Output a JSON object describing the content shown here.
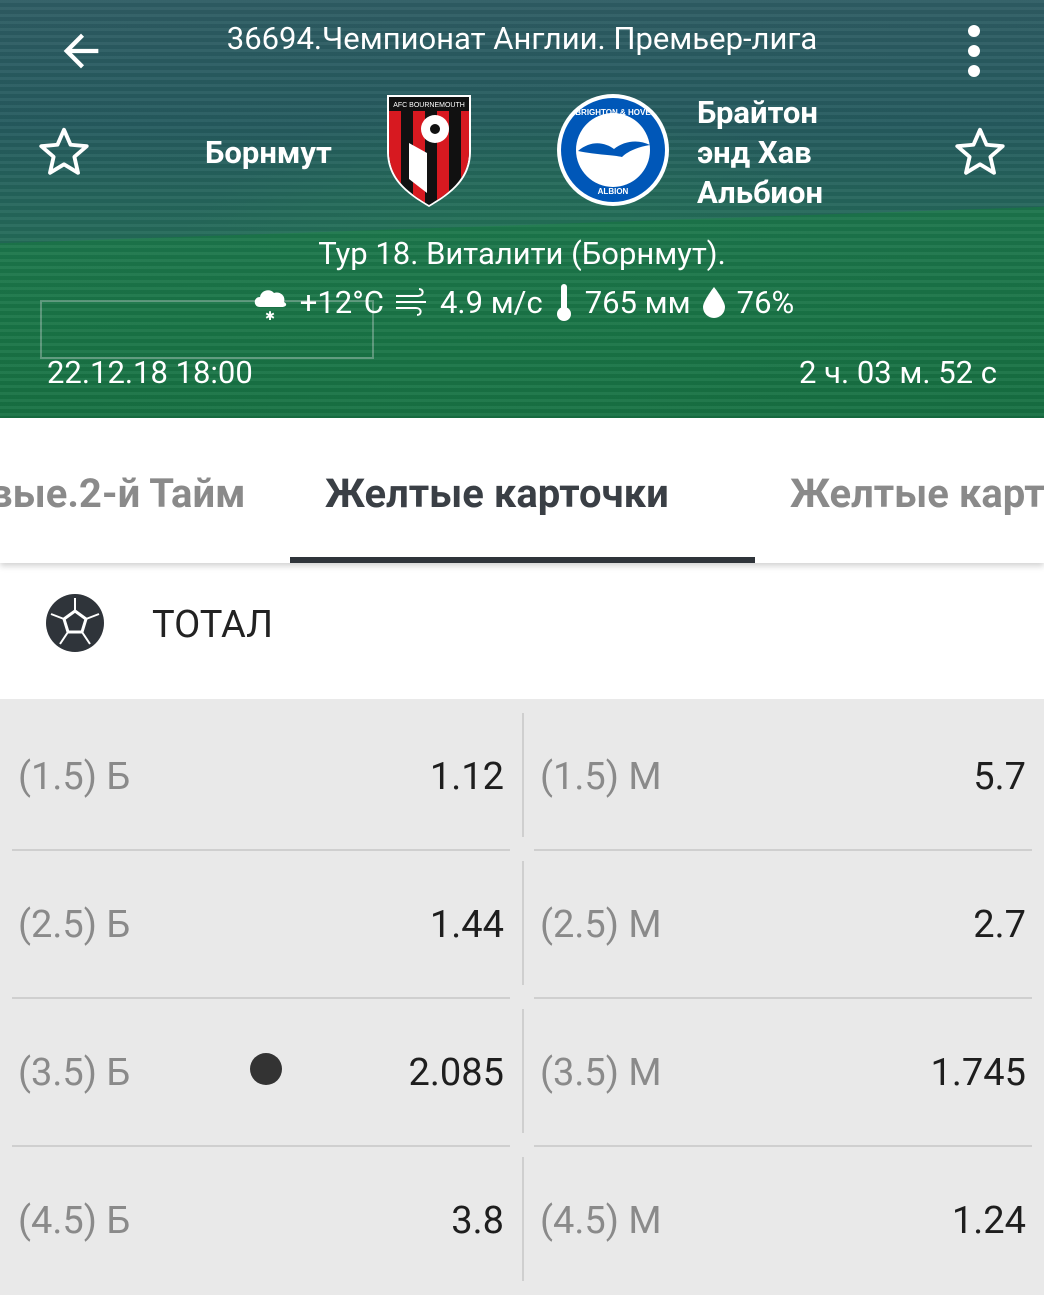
{
  "header": {
    "title": "36694.Чемпионат Англии. Премьер-лига",
    "home_team": "Борнмут",
    "away_team_line1": "Брайтон",
    "away_team_line2": "энд Хав",
    "away_team_line3": "Альбион",
    "venue": "Тур 18. Виталити (Борнмут).",
    "weather": {
      "temperature": "+12°C",
      "wind": "4.9 м/с",
      "pressure": "765 мм",
      "humidity": "76%"
    },
    "date": "22.12.18 18:00",
    "countdown": "2 ч. 03 м. 52 с",
    "home_logo_text": "AFC BOURNEMOUTH",
    "away_logo_text_top": "BRIGHTON & HOVE",
    "away_logo_text_bottom": "ALBION"
  },
  "tabs": [
    {
      "label": "вые.2-й  Тайм"
    },
    {
      "label": "Желтые карточки"
    },
    {
      "label": "Желтые карт"
    }
  ],
  "section": {
    "title": "ТОТАЛ"
  },
  "odds": [
    {
      "left_label": "(1.5) Б",
      "left_value": "1.12",
      "right_label": "(1.5) М",
      "right_value": "5.7"
    },
    {
      "left_label": "(2.5) Б",
      "left_value": "1.44",
      "right_label": "(2.5) М",
      "right_value": "2.7"
    },
    {
      "left_label": "(3.5) Б",
      "left_value": "2.085",
      "right_label": "(3.5) М",
      "right_value": "1.745"
    },
    {
      "left_label": "(4.5) Б",
      "left_value": "3.8",
      "right_label": "(4.5) М",
      "right_value": "1.24"
    }
  ],
  "colors": {
    "accent_dark": "#2f343a",
    "bournemouth_red": "#d71920",
    "brighton_blue": "#0057b8"
  }
}
